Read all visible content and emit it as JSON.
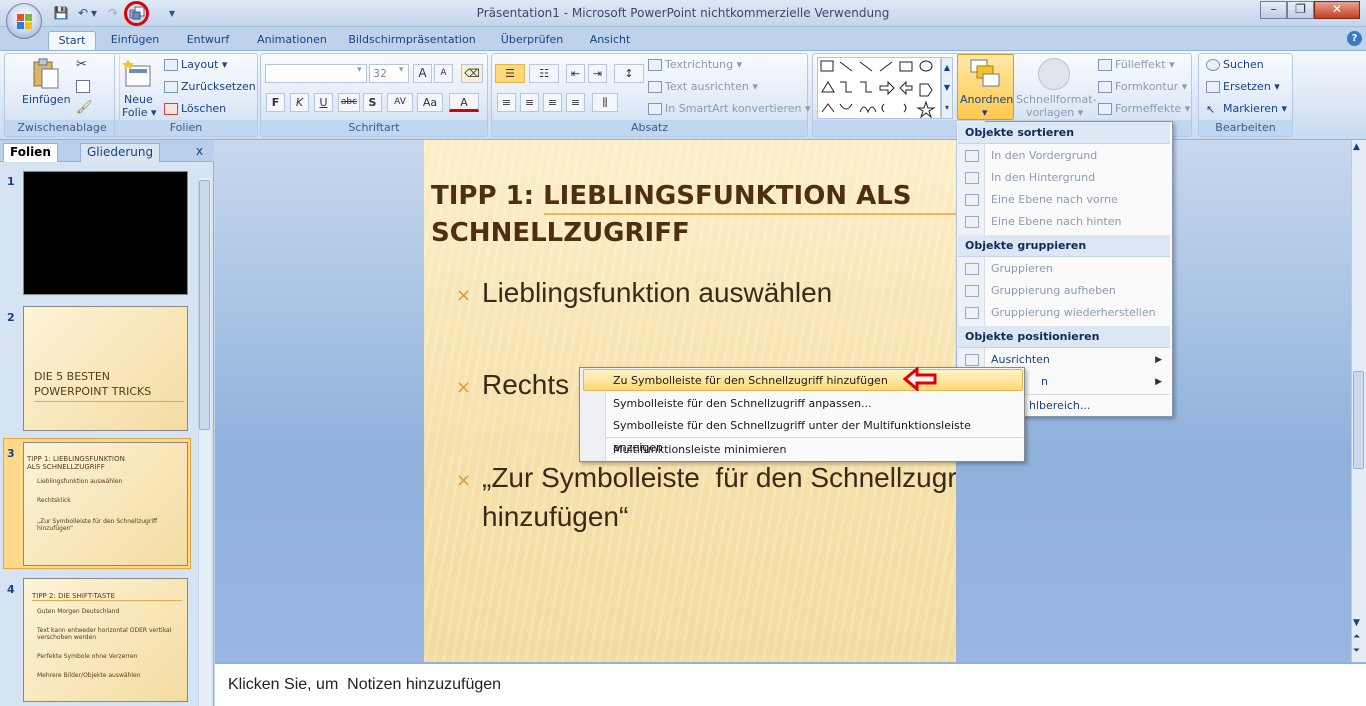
{
  "window": {
    "title": "Präsentation1 - Microsoft PowerPoint nichtkommerzielle Verwendung",
    "minimize": "–",
    "restore": "❐",
    "close": "✕"
  },
  "qat": {
    "save": "💾",
    "undo": "↶",
    "undo_drop": "▾",
    "redo": "↷",
    "customize": "▾"
  },
  "tabs": [
    "Start",
    "Einfügen",
    "Entwurf",
    "Animationen",
    "Bildschirmpräsentation",
    "Überprüfen",
    "Ansicht"
  ],
  "help": "?",
  "ribbon": {
    "clipboard": {
      "paste": "Einfügen",
      "label": "Zwischenablage"
    },
    "slides": {
      "new_slide_1": "Neue",
      "new_slide_2": "Folie ▾",
      "layout": "Layout ▾",
      "reset": "Zurücksetzen",
      "delete": "Löschen",
      "label": "Folien"
    },
    "font": {
      "size": "32",
      "label": "Schriftart",
      "bold": "F",
      "italic": "K",
      "underline": "U",
      "strike": "abc",
      "shadow": "S",
      "spacing": "AV",
      "case": "Aa",
      "color": "A",
      "grow": "A",
      "shrink": "A"
    },
    "paragraph": {
      "text_direction": "Textrichtung ▾",
      "align_text": "Text ausrichten ▾",
      "smartart": "In SmartArt konvertieren ▾",
      "label": "Absatz"
    },
    "drawing": {
      "arrange_1": "Anordnen",
      "arrange_2": "▾",
      "quickstyles_1": "Schnellformat-",
      "quickstyles_2": "vorlagen ▾",
      "fill": "Fülleffekt ▾",
      "outline": "Formkontur ▾",
      "effects": "Formeffekte ▾"
    },
    "editing": {
      "find": "Suchen",
      "replace": "Ersetzen ▾",
      "select": "Markieren ▾",
      "label": "Bearbeiten"
    }
  },
  "panes": {
    "slides_tab": "Folien",
    "outline_tab": "Gliederung",
    "close": "x"
  },
  "thumbnails": [
    {
      "num": "1"
    },
    {
      "num": "2",
      "title": "DIE 5 BESTEN POWERPOINT TRICKS"
    },
    {
      "num": "3",
      "title": "TIPP 1: LIEBLINGSFUNKTION ALS SCHNELLZUGRIFF",
      "bullets": [
        "Lieblingsfunktion auswählen",
        "Rechtsklick",
        "„Zur Symbolleiste für den Schnellzugriff hinzufügen“"
      ]
    },
    {
      "num": "4",
      "title": "TIPP 2: DIE SHIFT-TASTE",
      "bullets": [
        "Guten Morgen Deutschland",
        "Text kann entweder horizontal ODER vertikal verschoben werden",
        "Perfekte Symbole ohne Verzerren",
        "Mehrere Bilder/Objekte auswählen"
      ]
    }
  ],
  "slide": {
    "title_line1": "TIPP 1: LIEBLINGSFUNKTION ALS",
    "title_line2": "SCHNELLZUGRIFF",
    "bullet_mark": "×",
    "bullets": [
      "Lieblingsfunktion auswählen",
      "Rechts",
      "„Zur Symbolleiste  für den Schnellzugriff",
      "hinzufügen“"
    ]
  },
  "notes": {
    "placeholder": "Klicken Sie, um  Notizen hinzuzufügen"
  },
  "arrange_menu": {
    "sort_header": "Objekte sortieren",
    "sort_items": [
      "In den Vordergrund",
      "In den Hintergrund",
      "Eine Ebene nach vorne",
      "Eine Ebene nach hinten"
    ],
    "group_header": "Objekte gruppieren",
    "group_items": [
      "Gruppieren",
      "Gruppierung aufheben",
      "Gruppierung wiederherstellen"
    ],
    "position_header": "Objekte positionieren",
    "align": "Ausrichten",
    "rotate": "n",
    "selection_pane": "hlbereich..."
  },
  "context_menu": {
    "items": [
      "Zu Symbolleiste für den Schnellzugriff hinzufügen",
      "Symbolleiste für den Schnellzugriff anpassen...",
      "Symbolleiste für den Schnellzugriff unter der Multifunktionsleiste anzeigen",
      "Multifunktionsleiste minimieren"
    ]
  },
  "colors": {
    "accent_red": "#e00000",
    "highlight": "#ffd878",
    "slide_title": "#4e2f10",
    "bullet_mark": "#e0963a"
  }
}
